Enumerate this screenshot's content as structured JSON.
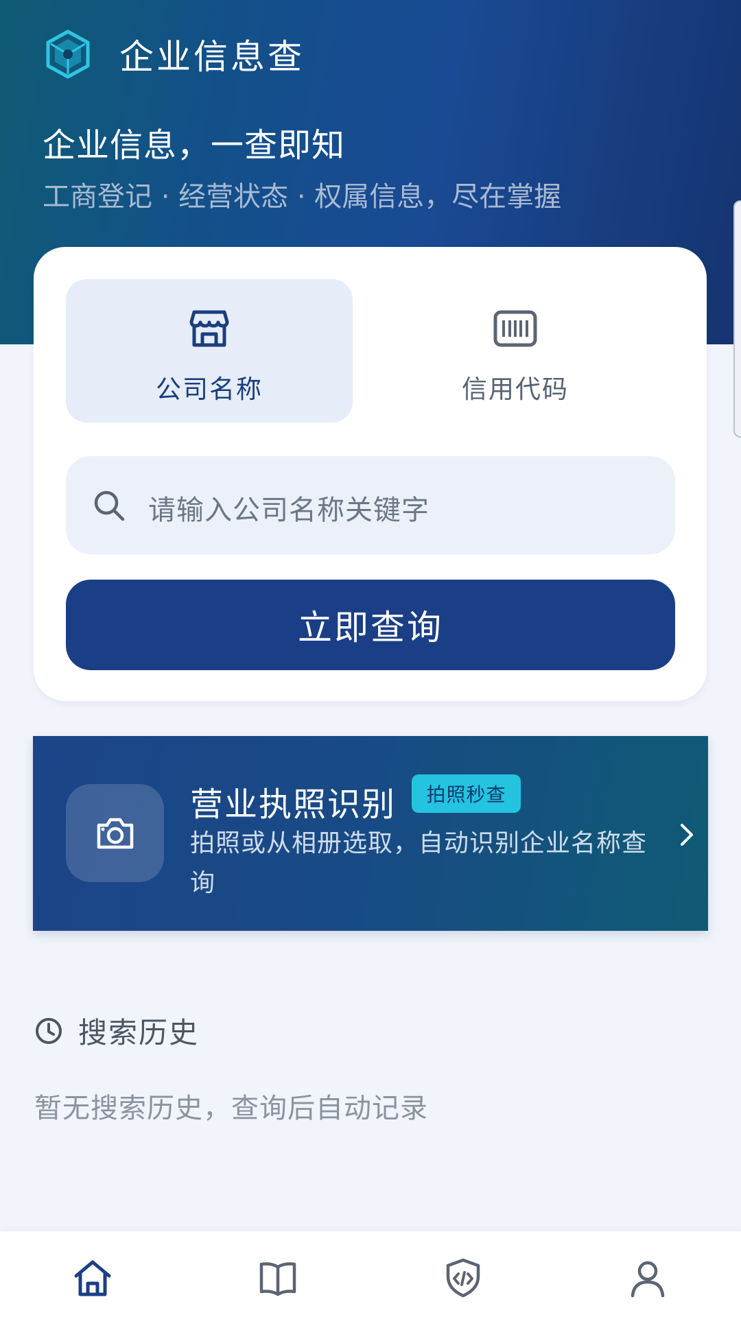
{
  "brand": {
    "title": "企业信息查",
    "logo_icon": "cube-logo-icon"
  },
  "hero": {
    "headline": "企业信息，一查即知",
    "subtitle": "工商登记 · 经营状态 · 权属信息，尽在掌握"
  },
  "search_card": {
    "tabs": [
      {
        "label": "公司名称",
        "icon": "storefront-icon",
        "selected": true
      },
      {
        "label": "信用代码",
        "icon": "barcode-icon",
        "selected": false
      }
    ],
    "search_placeholder": "请输入公司名称关键字",
    "submit_label": "立即查询"
  },
  "ocr": {
    "title": "营业执照识别",
    "badge": "拍照秒查",
    "description": "拍照或从相册选取，自动识别企业名称查询",
    "icon": "camera-icon"
  },
  "history": {
    "title": "搜索历史",
    "empty_text": "暂无搜索历史，查询后自动记录",
    "icon": "clock-icon"
  },
  "bottom_nav": [
    {
      "icon": "home-icon",
      "active": true
    },
    {
      "icon": "book-icon",
      "active": false
    },
    {
      "icon": "shield-code-icon",
      "active": false
    },
    {
      "icon": "user-icon",
      "active": false
    }
  ],
  "colors": {
    "primary": "#1a3f87",
    "accent": "#24c3e0",
    "page_bg": "#f1f4fb",
    "nav_active": "#1a3f87",
    "nav_inactive": "#5b6472"
  }
}
